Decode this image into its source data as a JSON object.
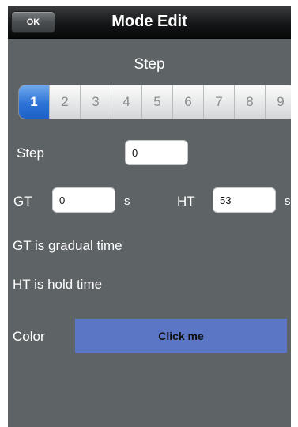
{
  "navbar": {
    "ok_label": "OK",
    "title": "Mode Edit"
  },
  "step_section": {
    "title": "Step",
    "segments": [
      "1",
      "2",
      "3",
      "4",
      "5",
      "6",
      "7",
      "8",
      "9"
    ],
    "selected": "1"
  },
  "form": {
    "step_label": "Step",
    "step_value": "0",
    "gt_label": "GT",
    "gt_value": "0",
    "gt_unit": "s",
    "ht_label": "HT",
    "ht_value": "53",
    "ht_unit": "s"
  },
  "notes": {
    "gt_note": "GT is gradual time",
    "ht_note": "HT is hold time"
  },
  "color_row": {
    "label": "Color",
    "button_label": "Click me",
    "button_color": "#5b76c4"
  },
  "colors": {
    "background": "#5e6365",
    "selected_segment": "#2d72d6"
  }
}
